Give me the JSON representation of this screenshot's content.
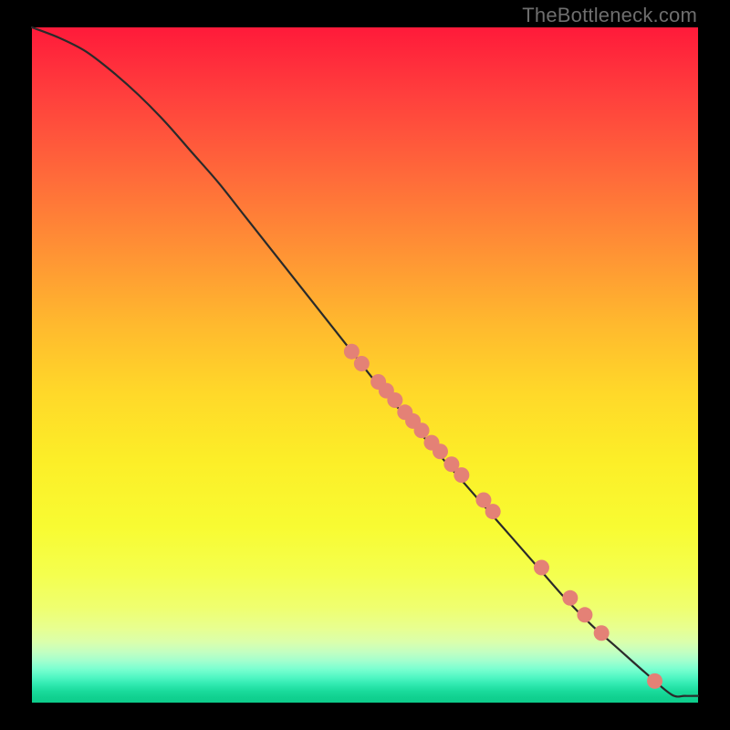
{
  "watermark": "TheBottleneck.com",
  "colors": {
    "curve_stroke": "#2a2a2a",
    "marker_fill": "#e48176",
    "marker_stroke": "#c95f55",
    "frame": "#000000"
  },
  "chart_data": {
    "type": "line",
    "title": "",
    "xlabel": "",
    "ylabel": "",
    "xlim": [
      0,
      100
    ],
    "ylim": [
      0,
      100
    ],
    "grid": false,
    "legend": false,
    "curve_note": "Monotone decreasing curve from top-left toward bottom-right, flattening near x≈96 at y≈1; values estimated from pixel position (no axis tick labels present).",
    "x": [
      0,
      4,
      8,
      12,
      16,
      20,
      24,
      28,
      32,
      36,
      40,
      44,
      48,
      52,
      56,
      60,
      64,
      68,
      72,
      76,
      80,
      84,
      88,
      92,
      96,
      98,
      100
    ],
    "y": [
      100,
      98.5,
      96.5,
      93.5,
      90,
      86,
      81.5,
      77,
      72,
      67,
      62,
      57,
      52,
      47,
      42.5,
      38,
      33.5,
      29,
      24.5,
      20,
      15.5,
      11.5,
      8,
      4.5,
      1.2,
      1.0,
      1.0
    ],
    "series": [
      {
        "name": "markers",
        "note": "Highlighted data points along the curve (salmon dots); x/y estimated from position.",
        "points": [
          {
            "x": 48.0,
            "y": 52.0
          },
          {
            "x": 49.5,
            "y": 50.2
          },
          {
            "x": 52.0,
            "y": 47.5
          },
          {
            "x": 53.2,
            "y": 46.2
          },
          {
            "x": 54.5,
            "y": 44.8
          },
          {
            "x": 56.0,
            "y": 43.0
          },
          {
            "x": 57.2,
            "y": 41.7
          },
          {
            "x": 58.5,
            "y": 40.3
          },
          {
            "x": 60.0,
            "y": 38.5
          },
          {
            "x": 61.3,
            "y": 37.2
          },
          {
            "x": 63.0,
            "y": 35.3
          },
          {
            "x": 64.5,
            "y": 33.7
          },
          {
            "x": 67.8,
            "y": 30.0
          },
          {
            "x": 69.2,
            "y": 28.3
          },
          {
            "x": 76.5,
            "y": 20.0
          },
          {
            "x": 80.8,
            "y": 15.5
          },
          {
            "x": 83.0,
            "y": 13.0
          },
          {
            "x": 85.5,
            "y": 10.3
          },
          {
            "x": 93.5,
            "y": 3.2
          }
        ]
      }
    ]
  }
}
